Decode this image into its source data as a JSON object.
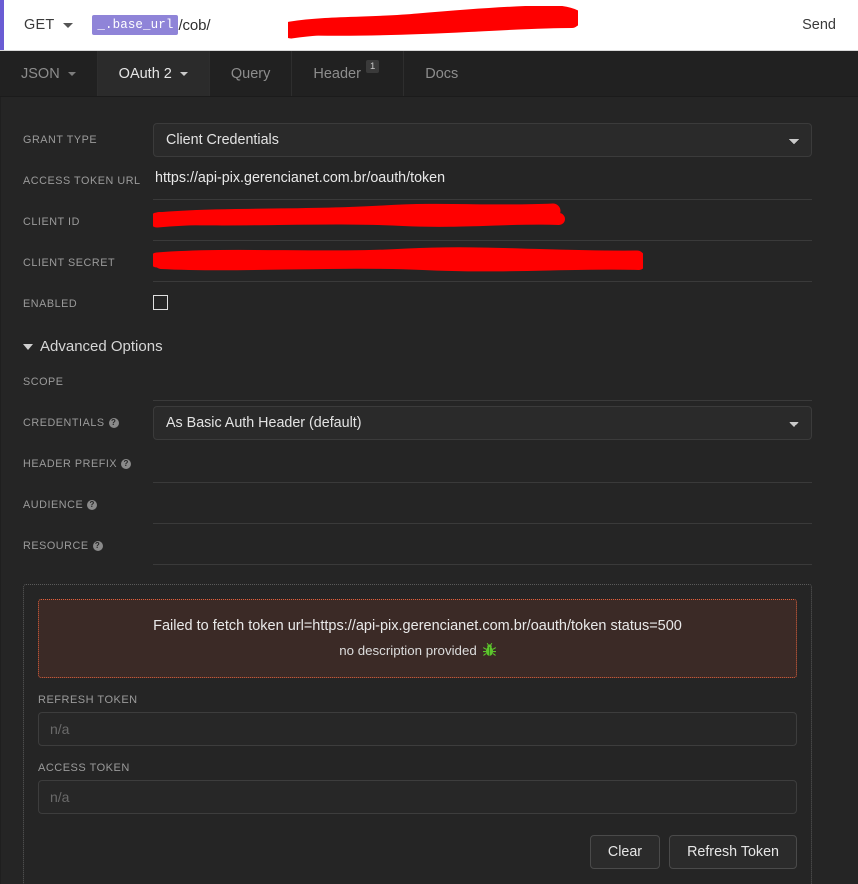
{
  "urlbar": {
    "method": "GET",
    "template_var": "_.base_url",
    "path": "/cob/",
    "send_label": "Send"
  },
  "tabs": [
    {
      "label": "JSON",
      "has_caret": true,
      "active": false,
      "badge": null
    },
    {
      "label": "OAuth 2",
      "has_caret": true,
      "active": true,
      "badge": null
    },
    {
      "label": "Query",
      "has_caret": false,
      "active": false,
      "badge": null
    },
    {
      "label": "Header",
      "has_caret": false,
      "active": false,
      "badge": "1"
    },
    {
      "label": "Docs",
      "has_caret": false,
      "active": false,
      "badge": null
    }
  ],
  "form": {
    "grant_type_label": "GRANT TYPE",
    "grant_type_value": "Client Credentials",
    "access_token_url_label": "ACCESS TOKEN URL",
    "access_token_url_value": "https://api-pix.gerencianet.com.br/oauth/token",
    "client_id_label": "CLIENT ID",
    "client_id_value": "",
    "client_secret_label": "CLIENT SECRET",
    "client_secret_value": "",
    "enabled_label": "ENABLED",
    "enabled_checked": true,
    "advanced_options_label": "Advanced Options",
    "scope_label": "SCOPE",
    "scope_value": "",
    "credentials_label": "CREDENTIALS",
    "credentials_value": "As Basic Auth Header (default)",
    "header_prefix_label": "HEADER PREFIX",
    "header_prefix_value": "",
    "audience_label": "AUDIENCE",
    "audience_value": "",
    "resource_label": "RESOURCE",
    "resource_value": "",
    "help_glyph": "?"
  },
  "token_panel": {
    "error_message": "Failed to fetch token url=https://api-pix.gerencianet.com.br/oauth/token status=500",
    "error_detail": "no description provided",
    "bug_icon": "🐛",
    "refresh_token_label": "REFRESH TOKEN",
    "refresh_token_placeholder": "n/a",
    "refresh_token_value": "",
    "access_token_label": "ACCESS TOKEN",
    "access_token_placeholder": "n/a",
    "access_token_value": "",
    "clear_label": "Clear",
    "refresh_label": "Refresh Token"
  },
  "colors": {
    "accent_purple": "#6a5cd4",
    "template_pill": "#8f84d8",
    "background": "#252525",
    "error_border": "#e0603c",
    "error_background": "#3b2a26",
    "redaction": "#ff0000"
  }
}
